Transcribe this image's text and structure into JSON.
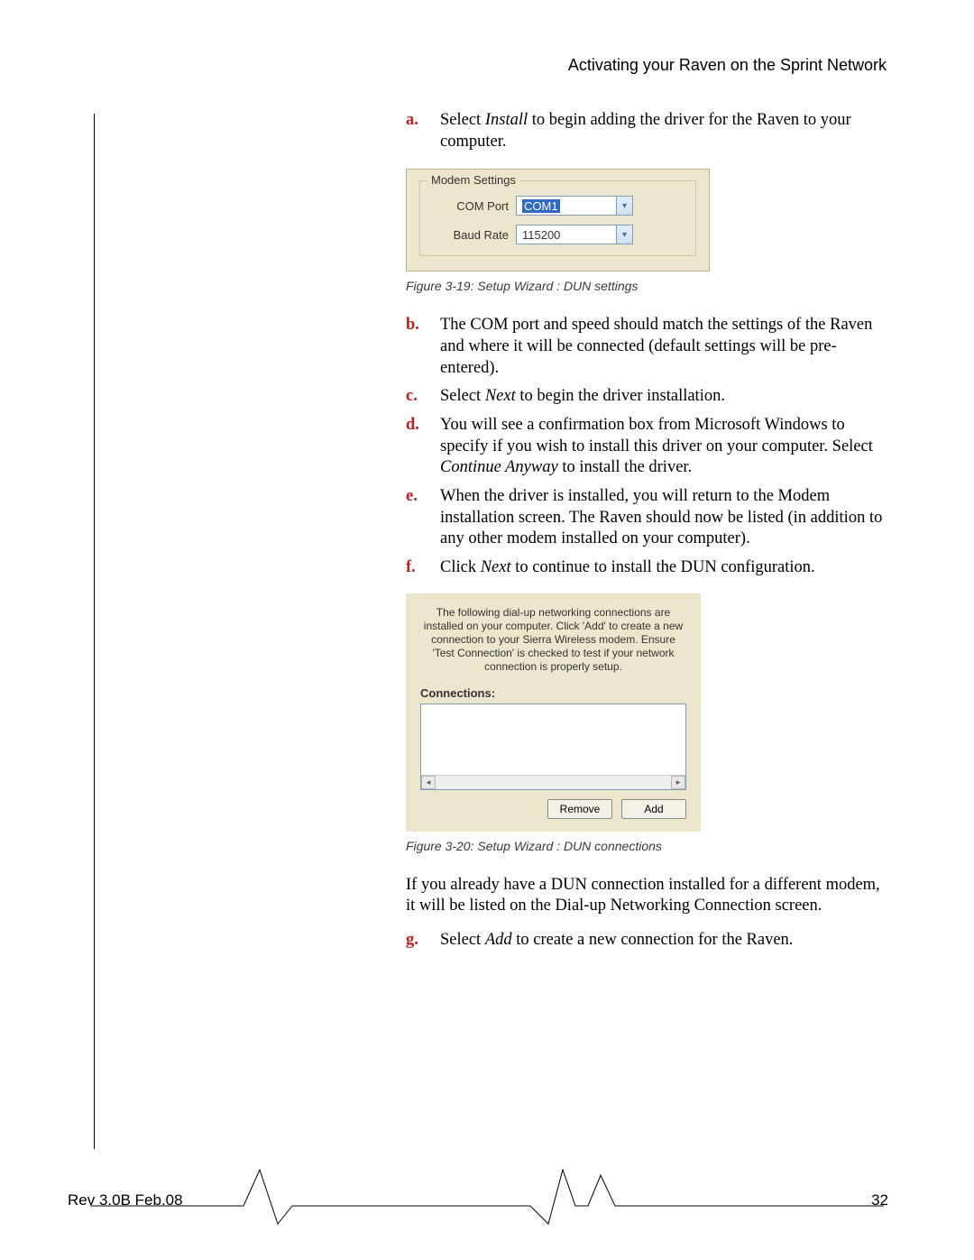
{
  "header": {
    "title": "Activating your Raven on the Sprint Network"
  },
  "steps": {
    "a": {
      "marker": "a.",
      "prefix": "Select ",
      "em": "Install",
      "suffix": " to begin adding the driver for the Raven to your computer."
    },
    "b": {
      "marker": "b.",
      "text": "The COM port and speed should match the settings of the Raven and where it will be connected (default settings will be pre-entered)."
    },
    "c": {
      "marker": "c.",
      "prefix": "Select ",
      "em": "Next",
      "suffix": " to begin the driver installation."
    },
    "d": {
      "marker": "d.",
      "prefix": "You will see a confirmation box from Microsoft Windows to specify if you wish to install this driver on your computer. Select ",
      "em": "Continue Anyway",
      "suffix": " to install the driver."
    },
    "e": {
      "marker": "e.",
      "text": "When the driver is installed, you will return to the Modem installation screen. The Raven should now be listed (in addition to any other modem installed on your computer)."
    },
    "f": {
      "marker": "f.",
      "prefix": "Click ",
      "em": "Next",
      "suffix": " to continue to install the DUN configu­ration."
    },
    "g": {
      "marker": "g.",
      "prefix": "Select ",
      "em": "Add",
      "suffix": " to create a new connection for the Raven."
    }
  },
  "fig1": {
    "legend": "Modem Settings",
    "com_label": "COM Port",
    "com_value": "COM1",
    "baud_label": "Baud Rate",
    "baud_value": "115200",
    "caption": "Figure 3-19: Setup Wizard : DUN settings"
  },
  "fig2": {
    "intro": "The following dial-up networking connections are installed on your computer. Click 'Add' to create a new connection to your Sierra Wireless modem. Ensure 'Test Connection' is checked to test if your network connection is properly setup.",
    "conn_label": "Connections:",
    "remove": "Remove",
    "add": "Add",
    "caption": "Figure 3-20: Setup Wizard : DUN connections"
  },
  "paragraph": "If you already have a DUN connection installed for a different modem, it will be listed on the Dial-up Networking Connection screen.",
  "footer": {
    "rev": "Rev 3.0B  Feb.08",
    "page": "32"
  }
}
